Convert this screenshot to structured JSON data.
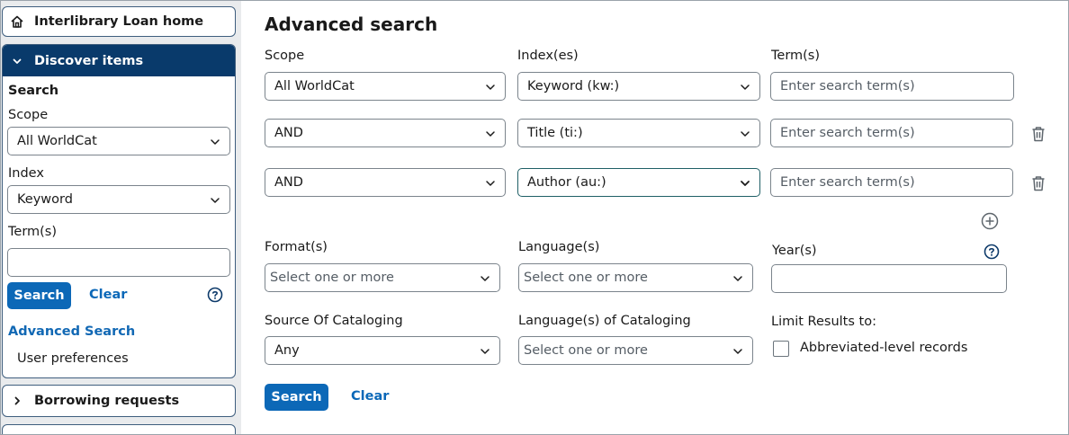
{
  "sidebar": {
    "home_label": "Interlibrary Loan home",
    "discover_label": "Discover items",
    "search_title": "Search",
    "scope_label": "Scope",
    "scope_value": "All WorldCat",
    "index_label": "Index",
    "index_value": "Keyword",
    "terms_label": "Term(s)",
    "terms_value": "",
    "search_button": "Search",
    "clear_button": "Clear",
    "advanced_search_link": "Advanced Search",
    "user_preferences_link": "User preferences",
    "borrowing_label": "Borrowing requests"
  },
  "main": {
    "title": "Advanced search",
    "col_scope_label": "Scope",
    "col_index_label": "Index(es)",
    "col_terms_label": "Term(s)",
    "rows": [
      {
        "operator": "All WorldCat",
        "index": "Keyword (kw:)",
        "term_placeholder": "Enter search term(s)"
      },
      {
        "operator": "AND",
        "index": "Title (ti:)",
        "term_placeholder": "Enter search term(s)"
      },
      {
        "operator": "AND",
        "index": "Author (au:)",
        "term_placeholder": "Enter search term(s)"
      }
    ],
    "formats_label": "Format(s)",
    "formats_placeholder": "Select one or more",
    "languages_label": "Language(s)",
    "languages_placeholder": "Select one or more",
    "years_label": "Year(s)",
    "source_label": "Source Of Cataloging",
    "source_value": "Any",
    "lang_cataloging_label": "Language(s) of Cataloging",
    "lang_cataloging_placeholder": "Select one or more",
    "limit_label": "Limit Results to:",
    "abbrev_label": "Abbreviated-level records",
    "abbrev_checked": false,
    "search_button": "Search",
    "clear_button": "Clear"
  },
  "icons": {
    "home": "home-icon",
    "chevron_down": "chevron-down-icon",
    "chevron_right": "chevron-right-icon",
    "help": "help-circle-icon",
    "trash": "trash-icon",
    "add": "plus-circle-icon"
  },
  "colors": {
    "primary": "#0c68b7",
    "nav_header": "#093a6b",
    "sidebar_bg": "#e9ebed"
  }
}
